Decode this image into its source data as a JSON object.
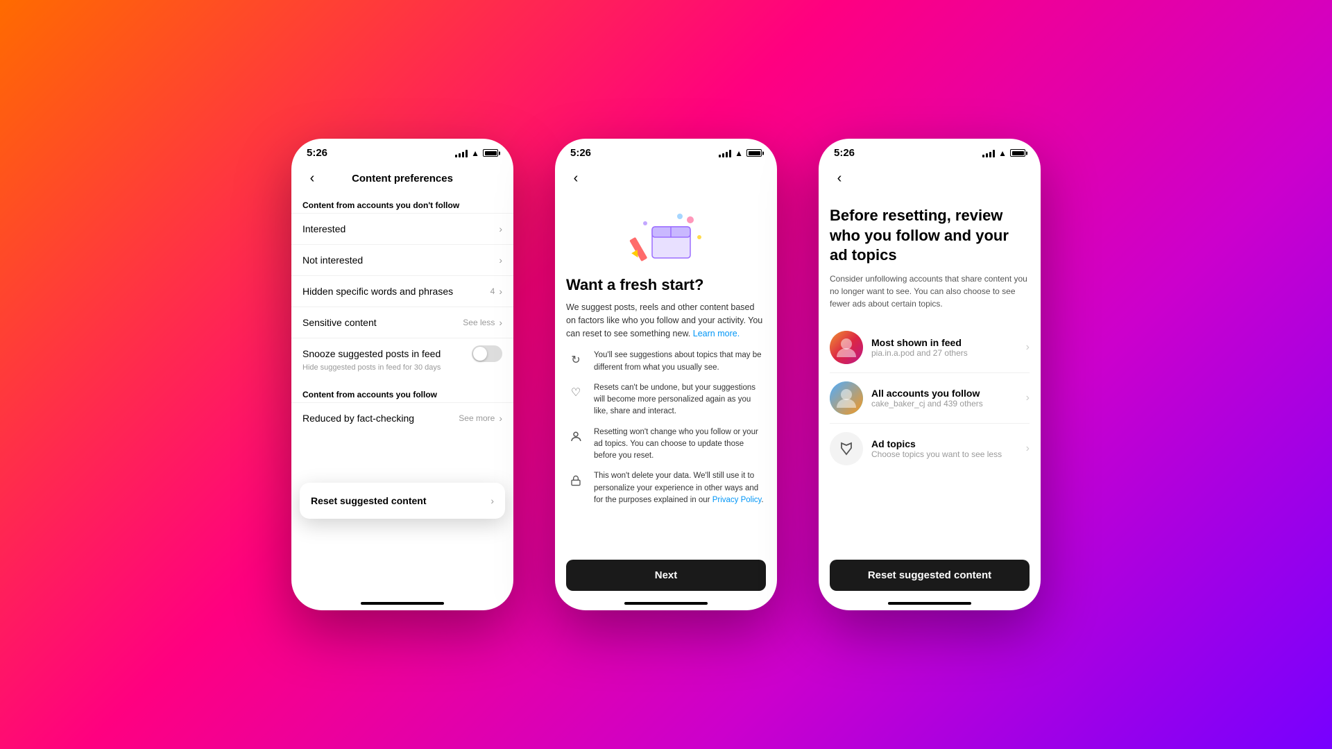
{
  "background": {
    "gradient": "linear-gradient(135deg, #ff6b00, #ff0080, #cc00cc, #7700ff)"
  },
  "phone1": {
    "status": {
      "time": "5:26"
    },
    "nav": {
      "title": "Content preferences",
      "back_label": "‹"
    },
    "section1_header": "Content from accounts you don't follow",
    "items": [
      {
        "label": "Interested",
        "right": ""
      },
      {
        "label": "Not interested",
        "right": ""
      },
      {
        "label": "Hidden specific words and phrases",
        "badge": "4",
        "right": ""
      },
      {
        "label": "Sensitive content",
        "right_text": "See less",
        "right": ""
      }
    ],
    "snooze": {
      "label": "Snooze suggested posts in feed",
      "sublabel": "Hide suggested posts in feed for 30 days"
    },
    "floating_card": {
      "label": "Reset suggested content"
    },
    "section2_header": "Content from accounts you follow",
    "items2": [
      {
        "label": "Reduced by fact-checking",
        "right_text": "See more"
      }
    ]
  },
  "phone2": {
    "status": {
      "time": "5:26"
    },
    "title": "Want a fresh start?",
    "description": "We suggest posts, reels and other content based on factors like who you follow and your activity. You can reset to see something new.",
    "learn_more": "Learn more.",
    "features": [
      {
        "icon": "↻",
        "text": "You'll see suggestions about topics that may be different from what you usually see."
      },
      {
        "icon": "♡",
        "text": "Resets can't be undone, but your suggestions will become more personalized again as you like, share and interact."
      },
      {
        "icon": "👤",
        "text": "Resetting won't change who you follow or your ad topics. You can choose to update those before you reset."
      },
      {
        "icon": "🔒",
        "text": "This won't delete your data. We'll still use it to personalize your experience in other ways and for the purposes explained in our Privacy Policy."
      }
    ],
    "privacy_link": "Privacy Policy",
    "next_button": "Next"
  },
  "phone3": {
    "status": {
      "time": "5:26"
    },
    "title": "Before resetting, review who you follow and your ad topics",
    "description": "Consider unfollowing accounts that share content you no longer want to see. You can also choose to see fewer ads about certain topics.",
    "accounts": [
      {
        "name": "Most shown in feed",
        "sub": "pia.in.a.pod and 27 others",
        "avatar_type": "gradient1"
      },
      {
        "name": "All accounts you follow",
        "sub": "cake_baker_cj and 439 others",
        "avatar_type": "gradient2"
      }
    ],
    "ad_topics": {
      "name": "Ad topics",
      "sub": "Choose topics you want to see less"
    },
    "reset_button": "Reset suggested content"
  }
}
